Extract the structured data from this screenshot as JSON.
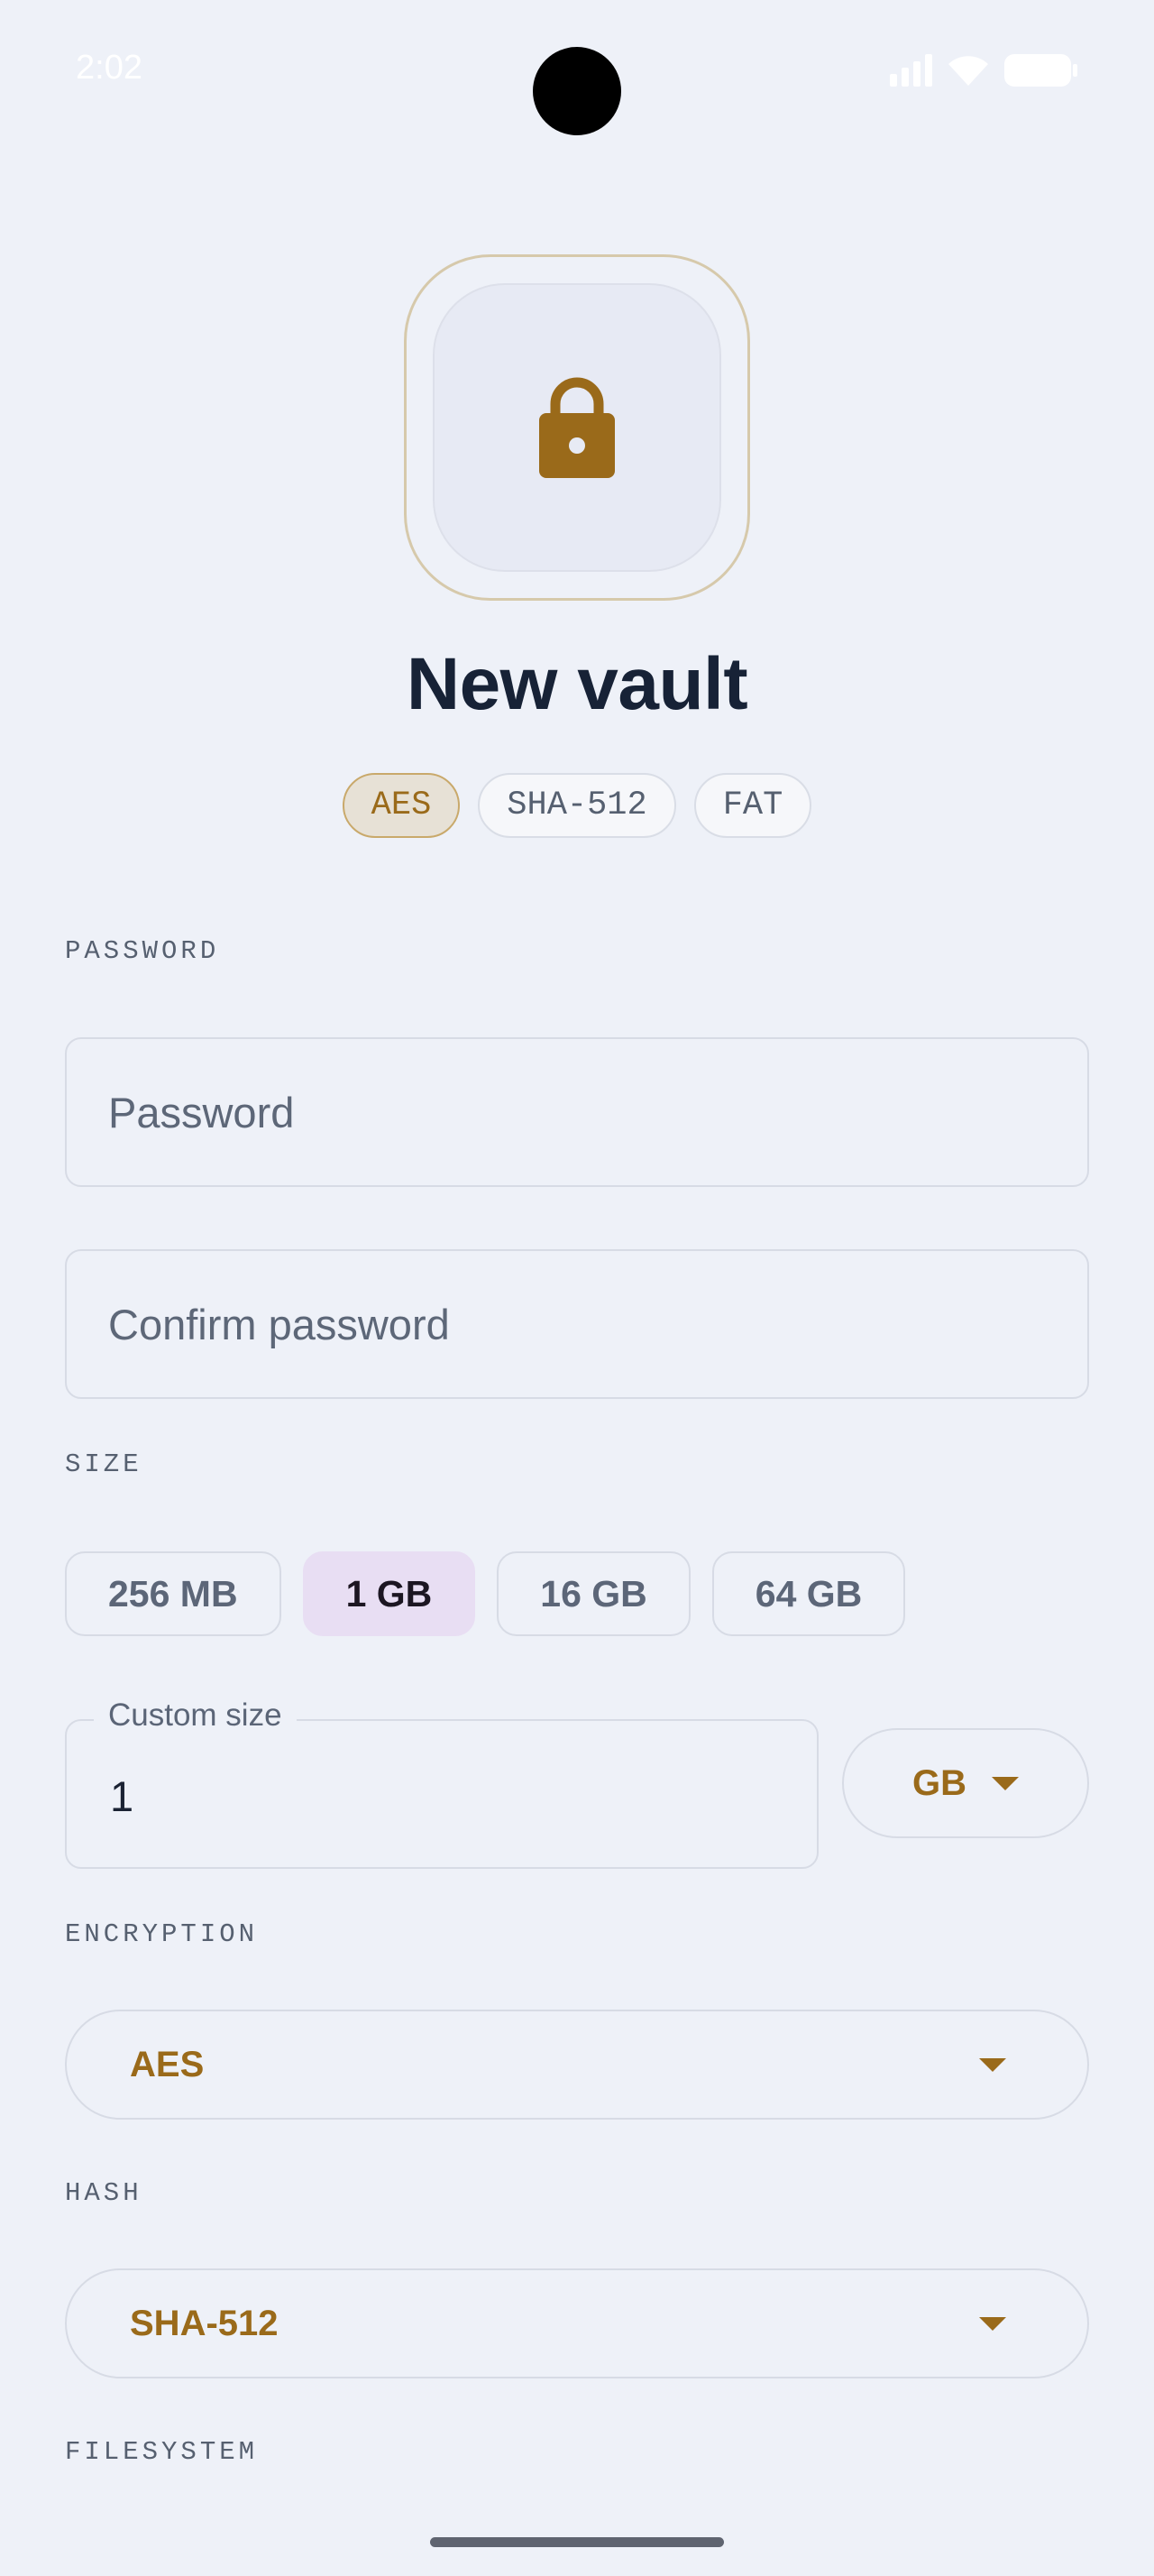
{
  "status_bar": {
    "time": "2:02",
    "icons": [
      "signal-icon",
      "wifi-icon",
      "battery-icon"
    ]
  },
  "hero": {
    "icon": "lock-icon",
    "title": "New vault"
  },
  "summary_chips": [
    {
      "label": "AES",
      "active": true
    },
    {
      "label": "SHA-512",
      "active": false
    },
    {
      "label": "FAT",
      "active": false
    }
  ],
  "password_section": {
    "label": "PASSWORD",
    "password_placeholder": "Password",
    "confirm_placeholder": "Confirm password"
  },
  "size_section": {
    "label": "SIZE",
    "options": [
      {
        "label": "256 MB",
        "selected": false
      },
      {
        "label": "1 GB",
        "selected": true
      },
      {
        "label": "16 GB",
        "selected": false
      },
      {
        "label": "64 GB",
        "selected": false
      }
    ],
    "custom_label": "Custom size",
    "custom_value": "1",
    "unit": "GB"
  },
  "encryption_section": {
    "label": "ENCRYPTION",
    "value": "AES"
  },
  "hash_section": {
    "label": "HASH",
    "value": "SHA-512"
  },
  "filesystem_section": {
    "label": "FILESYSTEM"
  },
  "colors": {
    "background": "#eef1f8",
    "accent": "#9a6a1a",
    "selected_chip": "#e8def3",
    "title": "#172236"
  }
}
